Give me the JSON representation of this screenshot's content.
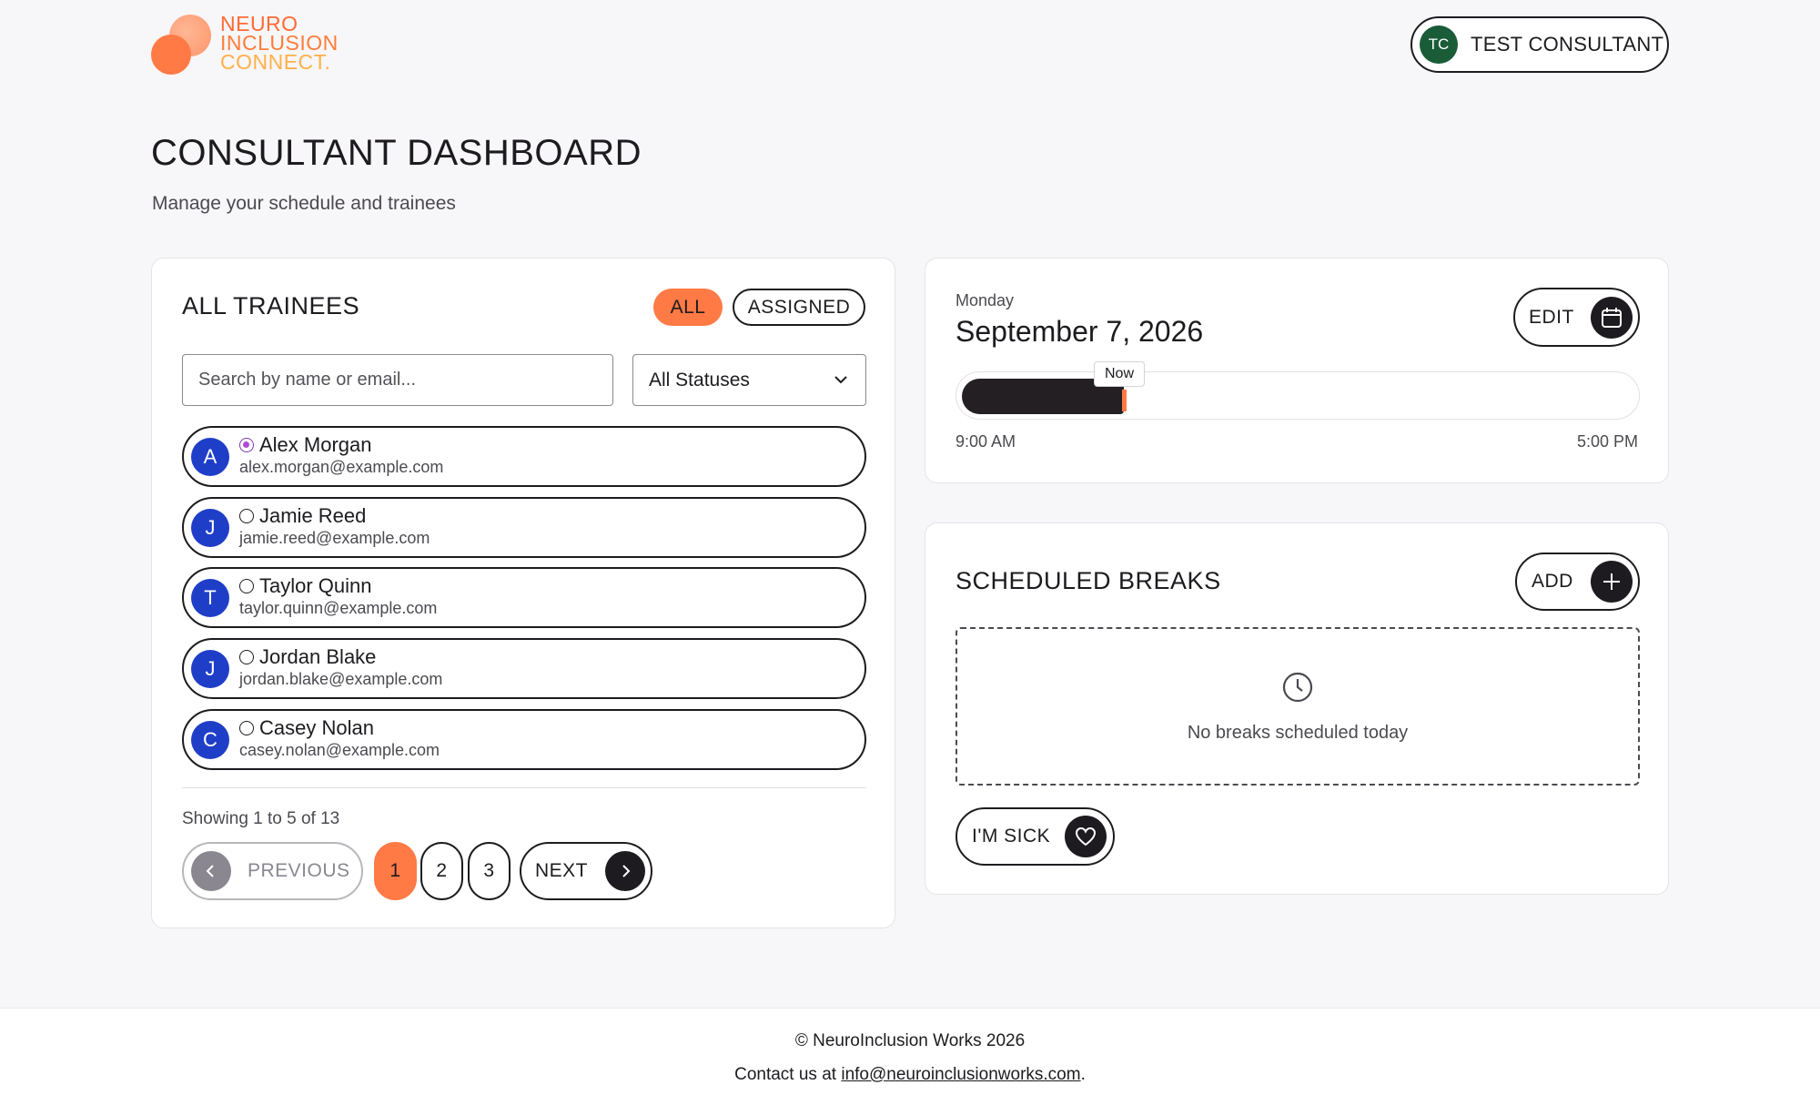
{
  "brand": {
    "logo_line1": "NEURO",
    "logo_line2": "INCLUSION",
    "logo_line3": "CONNECT.",
    "colors": {
      "primary": "#ff7a45",
      "dark": "#1d1b1f",
      "avatar_blue": "#1f3ec8",
      "user_green": "#1a5c38"
    }
  },
  "user": {
    "initials": "TC",
    "name": "TEST CONSULTANT"
  },
  "page": {
    "title": "CONSULTANT DASHBOARD",
    "subtitle": "Manage your schedule and trainees"
  },
  "trainees": {
    "title": "ALL TRAINEES",
    "filter_all": "ALL",
    "filter_assigned": "ASSIGNED",
    "search_placeholder": "Search by name or email...",
    "status_selected": "All Statuses",
    "items": [
      {
        "initial": "A",
        "name": "Alex Morgan",
        "email": "alex.morgan@example.com",
        "status": "active"
      },
      {
        "initial": "J",
        "name": "Jamie Reed",
        "email": "jamie.reed@example.com",
        "status": "inactive"
      },
      {
        "initial": "T",
        "name": "Taylor Quinn",
        "email": "taylor.quinn@example.com",
        "status": "inactive"
      },
      {
        "initial": "J",
        "name": "Jordan Blake",
        "email": "jordan.blake@example.com",
        "status": "inactive"
      },
      {
        "initial": "C",
        "name": "Casey Nolan",
        "email": "casey.nolan@example.com",
        "status": "inactive"
      }
    ],
    "showing": "Showing 1 to 5 of 13",
    "pagination": {
      "previous": "PREVIOUS",
      "next": "NEXT",
      "pages": [
        "1",
        "2",
        "3"
      ],
      "current_page": "1"
    }
  },
  "day": {
    "weekday": "Monday",
    "date": "September 7, 2026",
    "edit_label": "EDIT",
    "now_label": "Now",
    "start_time": "9:00 AM",
    "end_time": "5:00 PM",
    "progress_fraction": 0.24
  },
  "breaks": {
    "title": "SCHEDULED BREAKS",
    "add_label": "ADD",
    "empty_text": "No breaks scheduled today",
    "sick_label": "I'M SICK"
  },
  "footer": {
    "copyright": "© NeuroInclusion Works 2026",
    "contact_prefix": "Contact us at ",
    "contact_email": "info@neuroinclusionworks.com",
    "contact_suffix": "."
  }
}
